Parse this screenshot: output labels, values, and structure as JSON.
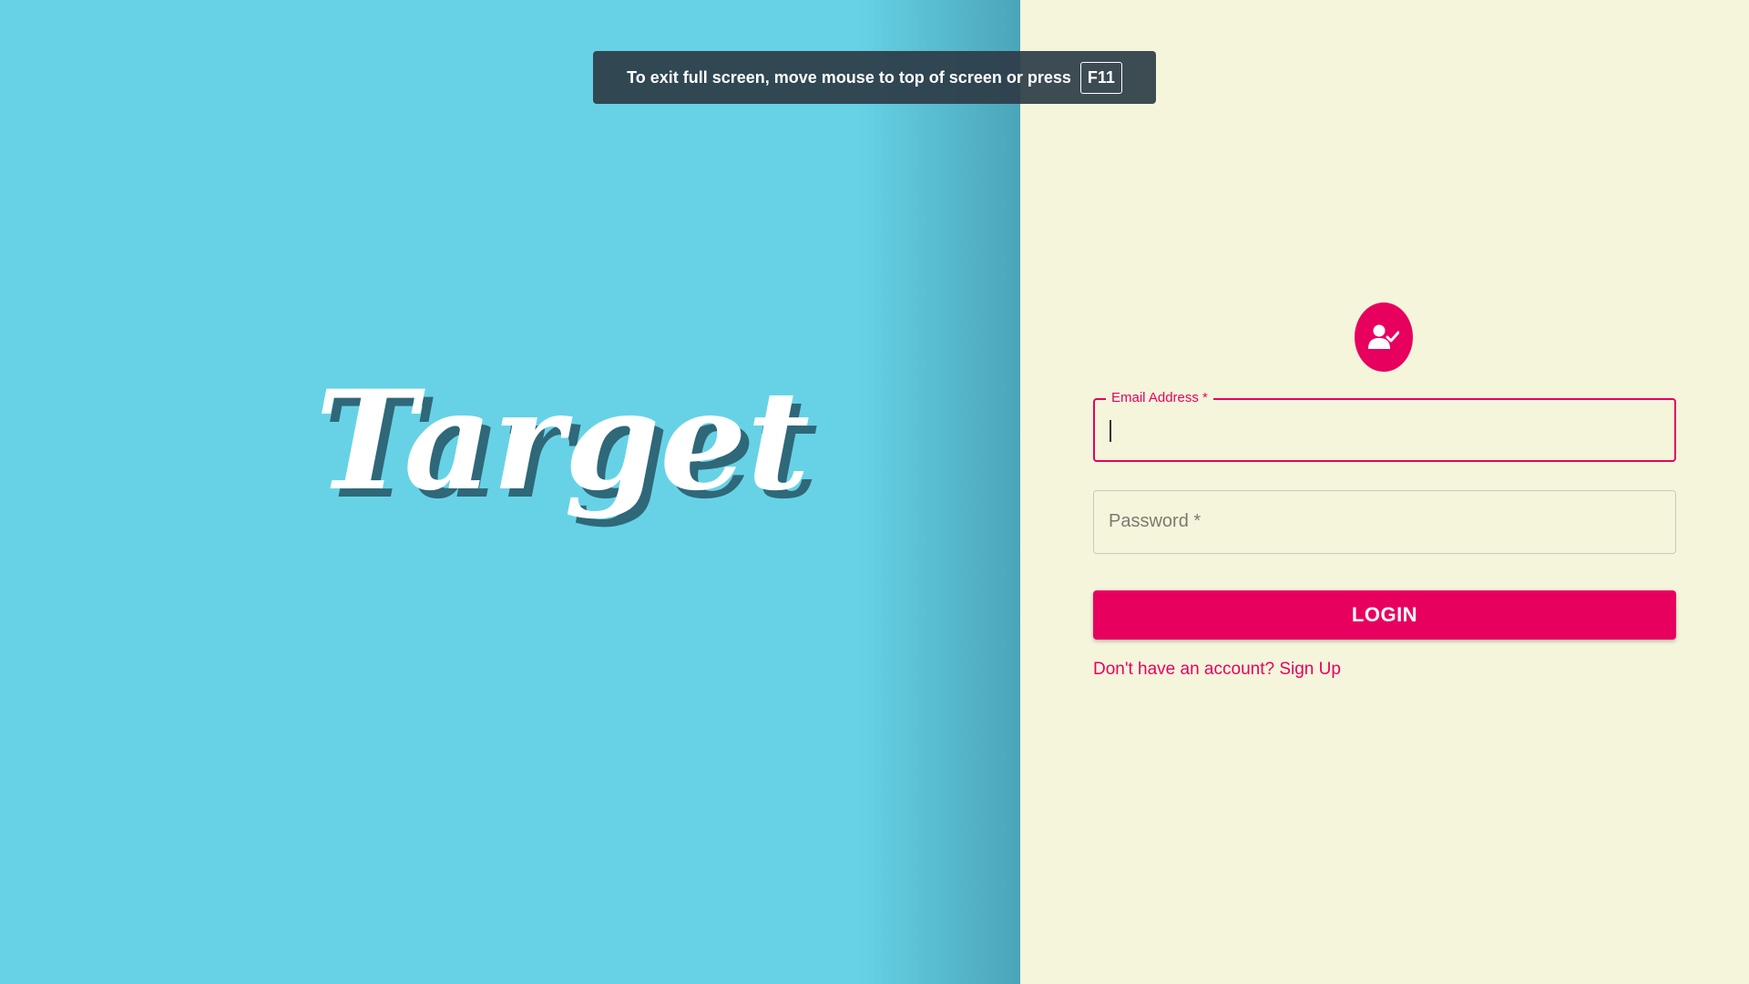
{
  "fullscreen_notice": {
    "message": "To exit full screen, move mouse to top of screen or press",
    "key": "F11"
  },
  "brand": {
    "logo_text": "Target"
  },
  "login_form": {
    "avatar_icon": "user-check-icon",
    "email": {
      "label": "Email Address *",
      "value": ""
    },
    "password": {
      "placeholder": "Password *",
      "value": ""
    },
    "login_label": "LOGIN",
    "signup_link": "Don't have an account? Sign Up"
  },
  "colors": {
    "left_background": "#67d2e6",
    "right_background": "#f5f5dc",
    "accent": "#e8005e",
    "toast_background": "#2d3c46"
  }
}
